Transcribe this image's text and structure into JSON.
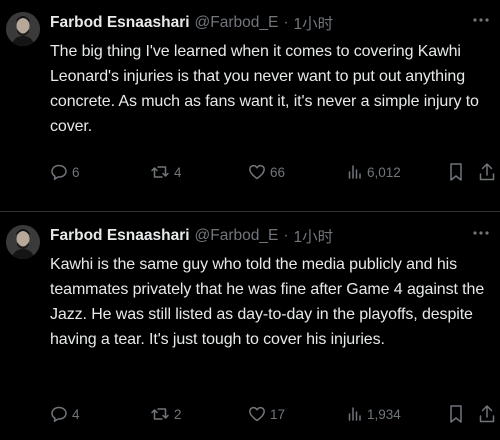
{
  "tweets": [
    {
      "name": "Farbod Esnaashari",
      "handle": "@Farbod_E",
      "separator": "·",
      "time": "1小时",
      "text": "The big thing I've learned when it comes to covering Kawhi Leonard's injuries is that you never want to put out anything concrete. As much as fans want it, it's never a simple injury to cover.",
      "replies": "6",
      "retweets": "4",
      "likes": "66",
      "views": "6,012"
    },
    {
      "name": "Farbod Esnaashari",
      "handle": "@Farbod_E",
      "separator": "·",
      "time": "1小时",
      "text": "Kawhi is the same guy who told the media publicly and his teammates privately that he was fine after Game 4 against the Jazz. He was still listed as day-to-day in the playoffs, despite having a tear. It's just tough to cover his injuries.",
      "replies": "4",
      "retweets": "2",
      "likes": "17",
      "views": "1,934"
    }
  ],
  "colors": {
    "background": "#000000",
    "text": "#e7e9ea",
    "secondary": "#71767b",
    "divider": "#2f3336"
  },
  "icons": [
    "more-icon",
    "reply-icon",
    "retweet-icon",
    "like-icon",
    "views-icon",
    "bookmark-icon",
    "share-icon"
  ]
}
